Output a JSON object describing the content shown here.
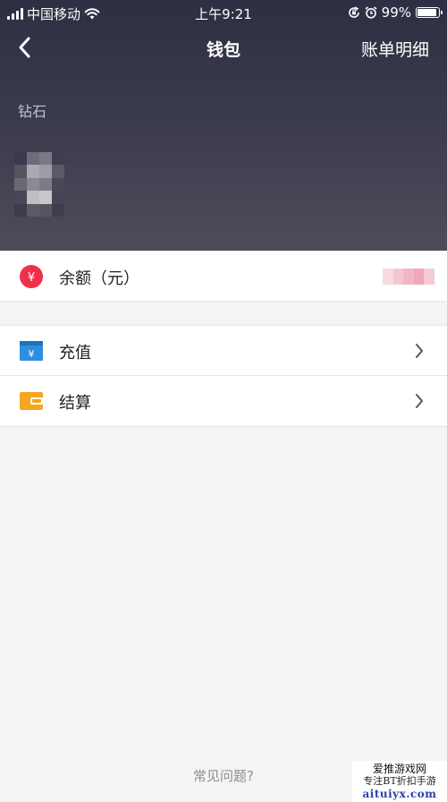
{
  "status_bar": {
    "carrier": "中国移动",
    "time": "上午9:21",
    "battery_percent": "99%",
    "battery_level": 0.99,
    "icons": [
      "signal-icon",
      "wifi-icon",
      "orientation-lock-icon",
      "alarm-icon",
      "battery-icon"
    ]
  },
  "nav": {
    "back_icon": "chevron-left-icon",
    "title": "钱包",
    "right_action": "账单明细"
  },
  "header": {
    "section_label": "钻石",
    "value_icon": "pixelated-redacted-value"
  },
  "balance_row": {
    "icon": "yen-badge-icon",
    "icon_symbol": "¥",
    "label": "余额（元）",
    "value_icon": "pixelated-redacted-value"
  },
  "menu": [
    {
      "icon": "recharge-card-icon",
      "icon_symbol": "¥",
      "label": "充值",
      "chevron": "chevron-right-icon"
    },
    {
      "icon": "wallet-icon",
      "label": "结算",
      "chevron": "chevron-right-icon"
    }
  ],
  "footer": {
    "faq_link": "常见问题?"
  },
  "watermark": {
    "line1": "爱推游戏网",
    "line2": "专注BT折扣手游",
    "line3": "aituiyx.com"
  },
  "colors": {
    "header_bg": "#36364a",
    "page_bg": "#f4f4f5",
    "yen_badge": "#f0304a",
    "recharge_icon": "#2e8fe0",
    "wallet_icon": "#f5a623",
    "watermark_link": "#2a3fa8"
  }
}
